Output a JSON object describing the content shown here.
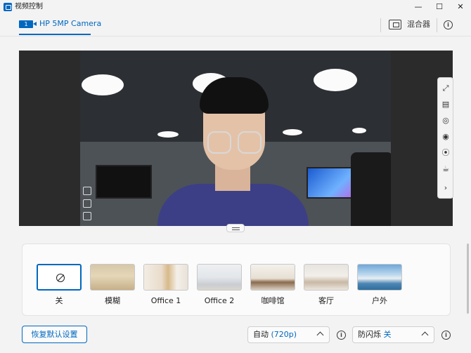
{
  "window": {
    "title": "视频控制",
    "minimize_glyph": "—",
    "maximize_glyph": "☐",
    "close_glyph": "✕"
  },
  "header": {
    "camera_index": "1",
    "camera_name": "HP 5MP Camera",
    "mixer_label": "混合器",
    "info_glyph": "i"
  },
  "side_toolbar": {
    "icons": [
      "expand-icon",
      "pdf-icon",
      "camera-icon",
      "record-icon",
      "broadcast-icon",
      "coffee-icon",
      "chevron-right-icon"
    ],
    "glyphs": [
      "⤢",
      "▤",
      "◎",
      "◉",
      "⦿",
      "☕",
      "›"
    ]
  },
  "backgrounds": {
    "items": [
      {
        "label": "关",
        "selected": true
      },
      {
        "label": "模糊",
        "selected": false
      },
      {
        "label": "Office 1",
        "selected": false
      },
      {
        "label": "Office 2",
        "selected": false
      },
      {
        "label": "咖啡馆",
        "selected": false
      },
      {
        "label": "客厅",
        "selected": false
      },
      {
        "label": "户外",
        "selected": false
      }
    ]
  },
  "controls": {
    "reset_label": "恢复默认设置",
    "resolution_label": "自动",
    "resolution_value": "(720p)",
    "flicker_label": "防闪烁",
    "flicker_value": "关",
    "info_glyph": "i"
  },
  "colors": {
    "accent": "#0067c0",
    "background": "#f3f3f3",
    "panel": "#fbfbfb"
  }
}
